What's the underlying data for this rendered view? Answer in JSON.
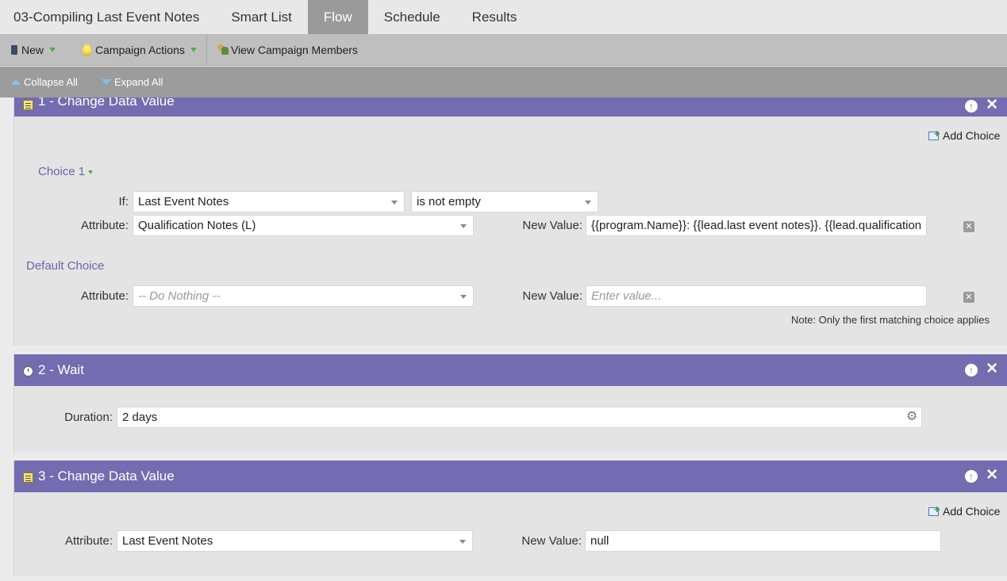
{
  "tabs": [
    "03-Compiling Last Event Notes",
    "Smart List",
    "Flow",
    "Schedule",
    "Results"
  ],
  "active_tab": "Flow",
  "toolbar": {
    "new_label": "New",
    "campaign_actions_label": "Campaign Actions",
    "view_members_label": "View Campaign Members"
  },
  "collapse": {
    "collapse_label": "Collapse All",
    "expand_label": "Expand All"
  },
  "steps": [
    {
      "title": "1 - Change Data Value",
      "add_choice": "Add Choice",
      "choice_label": "Choice 1",
      "if_label": "If:",
      "if_field": "Last Event Notes",
      "if_operator": "is not empty",
      "attribute_label": "Attribute:",
      "attribute_value": "Qualification Notes (L)",
      "new_value_label": "New Value:",
      "new_value": "{{program.Name}}: {{lead.last event notes}}. {{lead.qualification",
      "default_label": "Default Choice",
      "default_attribute": "-- Do Nothing --",
      "default_new_value_placeholder": "Enter value...",
      "note": "Note: Only the first matching choice applies"
    },
    {
      "title": "2 - Wait",
      "duration_label": "Duration:",
      "duration_value": "2 days"
    },
    {
      "title": "3 - Change Data Value",
      "add_choice": "Add Choice",
      "attribute_label": "Attribute:",
      "attribute_value": "Last Event Notes",
      "new_value_label": "New Value:",
      "new_value": "null"
    }
  ],
  "icons": {
    "up": "arrow-up-circle-icon",
    "close": "close-icon",
    "settings": "gear-icon",
    "delete": "delete-box-icon"
  },
  "colors": {
    "step_header": "#736cb0",
    "active_tab": "#9a9a9a",
    "link": "#6a63ad"
  }
}
